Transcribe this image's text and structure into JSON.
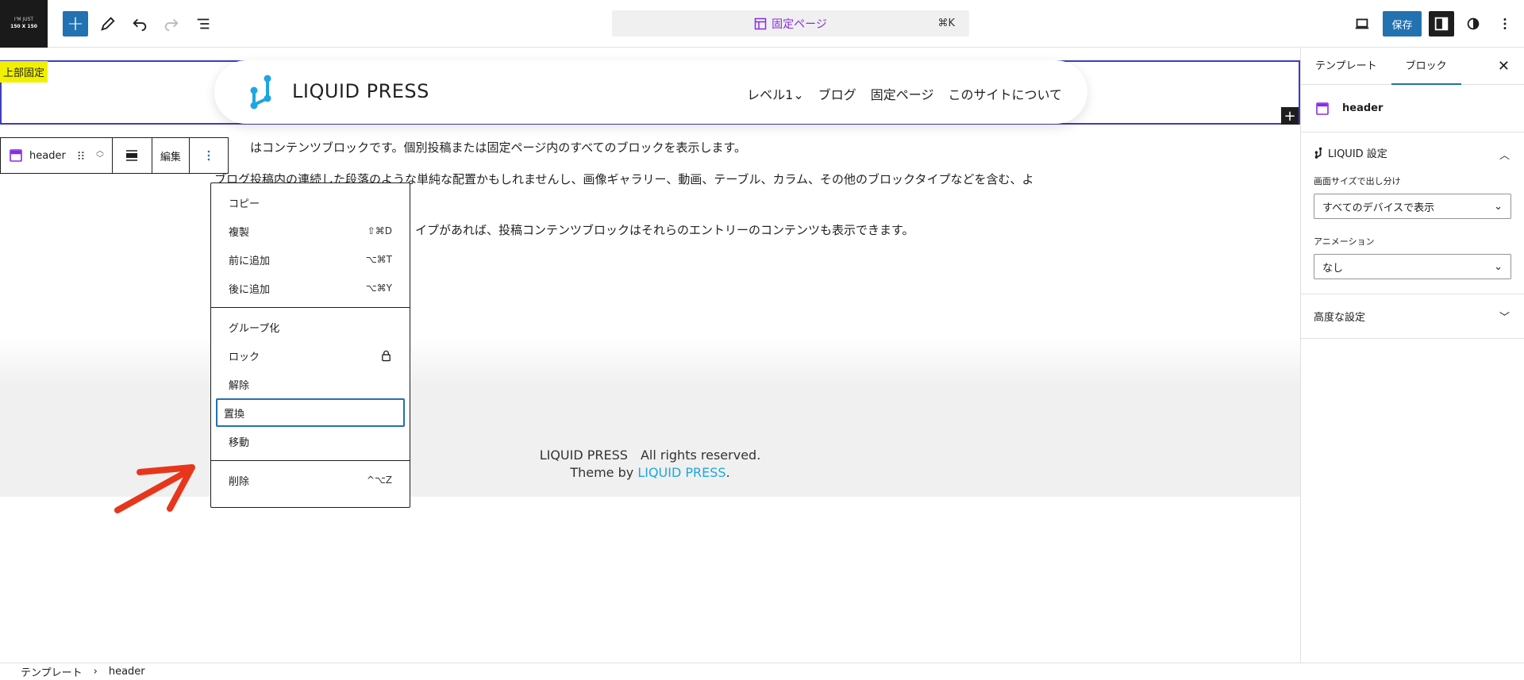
{
  "topbar": {
    "logo_line1": "I'M JUST",
    "logo_line2": "150 X 150",
    "command_label": "固定ページ",
    "command_shortcut": "⌘K",
    "save_label": "保存"
  },
  "canvas": {
    "fixed_tag": "上部固定",
    "brand_name": "LIQUID PRESS",
    "nav_links": [
      "レベル1⌄",
      "ブログ",
      "固定ページ",
      "このサイトについて"
    ],
    "block_toolbar": {
      "block_name": "header",
      "edit_label": "編集"
    },
    "paragraphs": [
      "はコンテンツブロックです。個別投稿または固定ページ内のすべてのブロックを表示します。",
      "ブログ投稿内の連続した段落のような単純な配置かもしれませんし、画像ギャラリー、動画、テーブル、カラム、その他のブロックタイプなどを含む、よ",
      "イプがあれば、投稿コンテンツブロックはそれらのエントリーのコンテンツも表示できます。"
    ],
    "footer_line1": "LIQUID PRESS　All rights reserved.",
    "footer_prefix": "Theme by ",
    "footer_link": "LIQUID PRESS",
    "footer_suffix": "."
  },
  "dropdown": {
    "groups": [
      [
        {
          "label": "コピー",
          "shortcut": ""
        },
        {
          "label": "複製",
          "shortcut": "⇧⌘D"
        },
        {
          "label": "前に追加",
          "shortcut": "⌥⌘T"
        },
        {
          "label": "後に追加",
          "shortcut": "⌥⌘Y"
        }
      ],
      [
        {
          "label": "グループ化",
          "shortcut": ""
        },
        {
          "label": "ロック",
          "shortcut": ""
        },
        {
          "label": "解除",
          "shortcut": ""
        },
        {
          "label": "置換",
          "shortcut": ""
        },
        {
          "label": "移動",
          "shortcut": ""
        }
      ],
      [
        {
          "label": "削除",
          "shortcut": "^⌥Z"
        }
      ]
    ]
  },
  "sidebar": {
    "tab_template": "テンプレート",
    "tab_block": "ブロック",
    "block_name": "header",
    "panel_title": "LIQUID 設定",
    "screen_label": "画面サイズで出し分け",
    "screen_value": "すべてのデバイスで表示",
    "animation_label": "アニメーション",
    "animation_value": "なし",
    "advanced_label": "高度な設定"
  },
  "breadcrumb": {
    "root": "テンプレート",
    "separator": "›",
    "current": "header"
  },
  "colors": {
    "accent": "#2271b1",
    "selection": "#3d3dbf",
    "brand_blue": "#1ea6e0",
    "template_purple": "#8a2be2",
    "fixed_tag_bg": "#f0f000",
    "annotation_arrow": "#e8361d"
  }
}
